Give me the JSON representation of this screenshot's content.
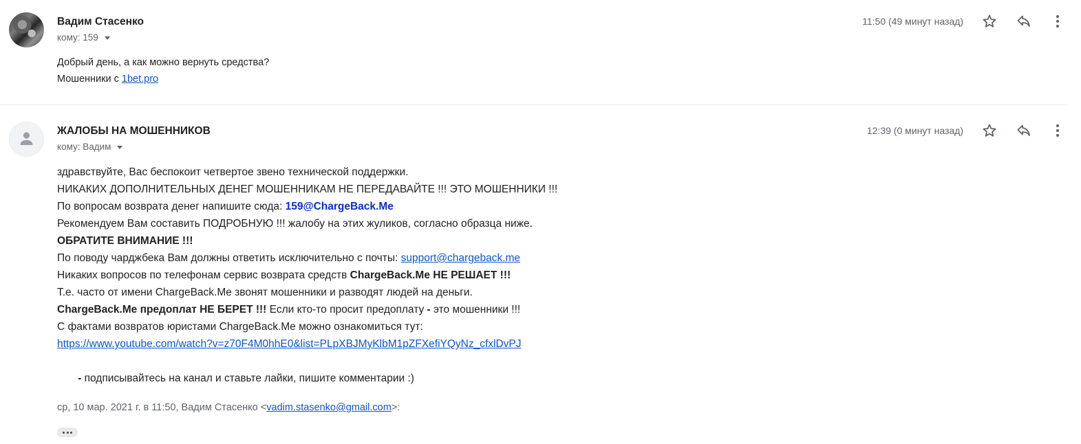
{
  "messages": [
    {
      "sender": "Вадим Стасенко",
      "recipient": "кому: 159",
      "time": "11:50 (49 минут назад)",
      "avatar": "photo",
      "body": {
        "line1": "Добрый день, а как можно вернуть средства?",
        "line2_prefix": "Мошенники с ",
        "line2_link": "1bet.pro"
      }
    },
    {
      "sender": "ЖАЛОБЫ НА МОШЕННИКОВ",
      "recipient": "кому: Вадим",
      "time": "12:39 (0 минут назад)",
      "avatar": "default-person",
      "body": {
        "l1": "здравствуйте, Вас беспокоит четвертое звено технической поддержки.",
        "l2": "НИКАКИХ ДОПОЛНИТЕЛЬНЫХ ДЕНЕГ МОШЕННИКАМ НЕ ПЕРЕДАВАЙТЕ !!! ЭТО МОШЕННИКИ !!!",
        "l3_prefix": "По вопросам возврата денег напишите сюда: ",
        "l3_email": "159@ChargeBack.Me",
        "l4": "Рекомендуем Вам составить ПОДРОБНУЮ !!! жалобу на этих жуликов, согласно образца ниже.",
        "l5": "ОБРАТИТЕ ВНИМАНИЕ !!!",
        "l6_prefix": "По поводу чарджбека Вам должны ответить исключительно с почты: ",
        "l6_link": "support@chargeback.me",
        "l7_prefix": "Никаких вопросов по телефонам сервис возврата средств ",
        "l7_bold": "ChargeBack.Me НЕ РЕШАЕТ !!!",
        "l8": "Т.е. часто от имени ChargeBack.Me звонят мошенники и разводят людей на деньги.",
        "l9_bold": "ChargeBack.Me предоплат НЕ БЕРЕТ !!!",
        "l9_mid": " Если кто-то просит предоплату ",
        "l9_dash": "-",
        "l9_suffix": " это мошенники !!!",
        "l10": "С фактами возвратов юристами ChargeBack.Me можно ознакомиться тут:",
        "l11_link": "https://www.youtube.com/watch?v=z70F4M0hhE0&list=PLpXBJMyKlbM1pZFXefiYQyNz_cfxlDvPJ",
        "l12_dash": " -",
        "l12_text": " подписывайтесь на канал и ставьте лайки, пишите комментарии :)"
      },
      "quote": {
        "prefix": "ср, 10 мар. 2021 г. в 11:50, Вадим Стасенко <",
        "email": "vadim.stasenko@gmail.com",
        "suffix": ">:"
      }
    }
  ],
  "icons": [
    "star-icon",
    "reply-icon",
    "more-vert-icon",
    "caret-down-icon",
    "person-icon",
    "ellipsis-icon"
  ],
  "colors": {
    "link": "#1155cc",
    "secondary_text": "#5f6368",
    "divider": "#e8eaed"
  }
}
